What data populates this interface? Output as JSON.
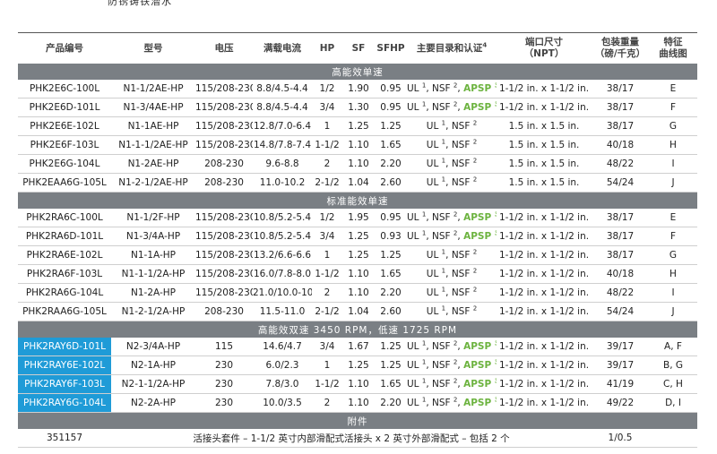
{
  "top_fragment": "防锈铸铁潜水",
  "columns": [
    "产品编号",
    "型号",
    "电压",
    "满载电流",
    "HP",
    "SF",
    "SFHP",
    "主要目录和认证",
    "端口尺寸\n（NPT）",
    "包装重量\n（磅/千克）",
    "特征\n曲线图"
  ],
  "columns_sup": "4",
  "cert_labels": {
    "ul": "UL",
    "nsf": "NSF",
    "apsp": "APSP"
  },
  "sections": [
    {
      "title": "高能效单速",
      "rows": [
        {
          "part": "PHK2E6C-100L",
          "model": "N1-1/2AE-HP",
          "voltage": "115/208-230",
          "amps": "8.8/4.5-4.4",
          "hp": "1/2",
          "sf": "1.90",
          "sfhp": "0.95",
          "apsp": true,
          "port": "1-1/2 in. x 1-1/2 in.",
          "weight": "38/17",
          "curve": "E"
        },
        {
          "part": "PHK2E6D-101L",
          "model": "N1-3/4AE-HP",
          "voltage": "115/208-230",
          "amps": "8.8/4.5-4.4",
          "hp": "3/4",
          "sf": "1.30",
          "sfhp": "0.95",
          "apsp": true,
          "port": "1-1/2 in. x 1-1/2 in.",
          "weight": "38/17",
          "curve": "F"
        },
        {
          "part": "PHK2E6E-102L",
          "model": "N1-1AE-HP",
          "voltage": "115/208-230",
          "amps": "12.8/7.0-6.4",
          "hp": "1",
          "sf": "1.25",
          "sfhp": "1.25",
          "apsp": false,
          "port": "1.5 in. x 1.5 in.",
          "weight": "38/17",
          "curve": "G"
        },
        {
          "part": "PHK2E6F-103L",
          "model": "N1-1-1/2AE-HP",
          "voltage": "115/208-230",
          "amps": "14.8/7.8-7.4",
          "hp": "1-1/2",
          "sf": "1.10",
          "sfhp": "1.65",
          "apsp": false,
          "port": "1.5 in. x 1.5 in.",
          "weight": "40/18",
          "curve": "H"
        },
        {
          "part": "PHK2E6G-104L",
          "model": "N1-2AE-HP",
          "voltage": "208-230",
          "amps": "9.6-8.8",
          "hp": "2",
          "sf": "1.10",
          "sfhp": "2.20",
          "apsp": false,
          "port": "1.5 in. x 1.5 in.",
          "weight": "48/22",
          "curve": "I"
        },
        {
          "part": "PHK2EAA6G-105L",
          "model": "N1-2-1/2AE-HP",
          "voltage": "208-230",
          "amps": "11.0-10.2",
          "hp": "2-1/2",
          "sf": "1.04",
          "sfhp": "2.60",
          "apsp": false,
          "port": "1.5 in. x 1.5 in.",
          "weight": "54/24",
          "curve": "J"
        }
      ]
    },
    {
      "title": "标准能效单速",
      "rows": [
        {
          "part": "PHK2RA6C-100L",
          "model": "N1-1/2F-HP",
          "voltage": "115/208-230",
          "amps": "10.8/5.2-5.4",
          "hp": "1/2",
          "sf": "1.95",
          "sfhp": "0.95",
          "apsp": true,
          "port": "1-1/2 in. x 1-1/2 in.",
          "weight": "38/17",
          "curve": "E"
        },
        {
          "part": "PHK2RA6D-101L",
          "model": "N1-3/4A-HP",
          "voltage": "115/208-230",
          "amps": "10.8/5.2-5.4",
          "hp": "3/4",
          "sf": "1.25",
          "sfhp": "0.93",
          "apsp": true,
          "port": "1-1/2 in. x 1-1/2 in.",
          "weight": "38/17",
          "curve": "F"
        },
        {
          "part": "PHK2RA6E-102L",
          "model": "N1-1A-HP",
          "voltage": "115/208-230",
          "amps": "13.2/6.6-6.6",
          "hp": "1",
          "sf": "1.25",
          "sfhp": "1.25",
          "apsp": false,
          "port": "1-1/2 in. x 1-1/2 in.",
          "weight": "38/17",
          "curve": "G"
        },
        {
          "part": "PHK2RA6F-103L",
          "model": "N1-1-1/2A-HP",
          "voltage": "115/208-230",
          "amps": "16.0/7.8-8.0",
          "hp": "1-1/2",
          "sf": "1.10",
          "sfhp": "1.65",
          "apsp": false,
          "port": "1-1/2 in. x 1-1/2 in.",
          "weight": "40/18",
          "curve": "H"
        },
        {
          "part": "PHK2RA6G-104L",
          "model": "N1-2A-HP",
          "voltage": "115/208-230",
          "amps": "21.0/10.0-10.5",
          "hp": "2",
          "sf": "1.10",
          "sfhp": "2.20",
          "apsp": false,
          "port": "1-1/2 in. x 1-1/2 in.",
          "weight": "48/22",
          "curve": "I"
        },
        {
          "part": "PHK2RAA6G-105L",
          "model": "N1-2-1/2A-HP",
          "voltage": "208-230",
          "amps": "11.5-11.0",
          "hp": "2-1/2",
          "sf": "1.04",
          "sfhp": "2.60",
          "apsp": false,
          "port": "1-1/2 in. x 1-1/2 in.",
          "weight": "54/24",
          "curve": "J"
        }
      ]
    },
    {
      "title": "高能效双速 3450 RPM，低速 1725 RPM",
      "rows": [
        {
          "part": "PHK2RAY6D-101L",
          "model": "N2-3/4A-HP",
          "voltage": "115",
          "amps": "14.6/4.7",
          "hp": "3/4",
          "sf": "1.67",
          "sfhp": "1.25",
          "apsp": true,
          "port": "1-1/2 in. x 1-1/2 in.",
          "weight": "39/17",
          "curve": "A, F",
          "highlight": true
        },
        {
          "part": "PHK2RAY6E-102L",
          "model": "N2-1A-HP",
          "voltage": "230",
          "amps": "6.0/2.3",
          "hp": "1",
          "sf": "1.25",
          "sfhp": "1.25",
          "apsp": true,
          "port": "1-1/2 in. x 1-1/2 in.",
          "weight": "39/17",
          "curve": "B, G",
          "highlight": true
        },
        {
          "part": "PHK2RAY6F-103L",
          "model": "N2-1-1/2A-HP",
          "voltage": "230",
          "amps": "7.8/3.0",
          "hp": "1-1/2",
          "sf": "1.10",
          "sfhp": "1.65",
          "apsp": true,
          "port": "1-1/2 in. x 1-1/2 in.",
          "weight": "41/19",
          "curve": "C, H",
          "highlight": true
        },
        {
          "part": "PHK2RAY6G-104L",
          "model": "N2-2A-HP",
          "voltage": "230",
          "amps": "10.0/3.5",
          "hp": "2",
          "sf": "1.10",
          "sfhp": "2.20",
          "apsp": true,
          "port": "1-1/2 in. x 1-1/2 in.",
          "weight": "49/22",
          "curve": "D, I",
          "highlight": true
        }
      ]
    }
  ],
  "accessories": {
    "title": "附件",
    "part": "351157",
    "description": "活接头套件 – 1-1/2 英寸内部滑配式活接头 x 2 英寸外部滑配式 – 包括 2 个",
    "weight": "1/0.5"
  }
}
